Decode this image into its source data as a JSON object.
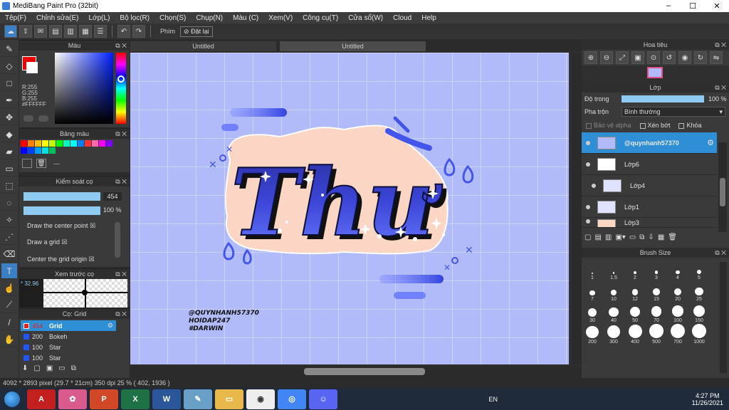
{
  "window": {
    "title": "MediBang Paint Pro (32bit)"
  },
  "menu": [
    "Tệp(F)",
    "Chỉnh sửa(E)",
    "Lớp(L)",
    "Bộ lọc(R)",
    "Chọn(S)",
    "Chụp(N)",
    "Màu (C)",
    "Xem(V)",
    "Công cụ(T)",
    "Cửa sổ(W)",
    "Cloud",
    "Help"
  ],
  "toolbar": {
    "shortcut_label": "Phím",
    "reset_label": "Đặt lại"
  },
  "color_panel": {
    "title": "Màu",
    "r": "R:255",
    "g": "G:255",
    "b": "B:255",
    "hex": "#FFFFFF"
  },
  "palette_panel": {
    "title": "Bảng màu",
    "dash": "---",
    "swatches": [
      "#ff0000",
      "#ff8000",
      "#ffbf00",
      "#ffff00",
      "#c0ff00",
      "#00ff00",
      "#00ffbf",
      "#00ffff",
      "#0080ff",
      "#ff3333",
      "#ff66aa",
      "#ff00ff",
      "#8000ff",
      "#0000ff",
      "#0040ff",
      "#00a0ff",
      "#00e0e0",
      "#00c060"
    ]
  },
  "brush_control": {
    "title": "Kiểm soát cọ",
    "size_value": "454",
    "opacity_value": "100 %",
    "size_fill": 1.0,
    "opacity_fill": 1.0,
    "options": [
      "Draw the center point",
      "Draw a grid",
      "Center the grid origin"
    ]
  },
  "preview_panel": {
    "title": "Xem trước cọ",
    "zoom": "* 32.96"
  },
  "brush_list": {
    "title": "Cọ: Grid",
    "items": [
      {
        "size": "454",
        "name": "Grid",
        "color": "#e02020"
      },
      {
        "size": "200",
        "name": "Bokeh",
        "color": "#2255ff"
      },
      {
        "size": "100",
        "name": "Star",
        "color": "#2255ff"
      },
      {
        "size": "100",
        "name": "Star",
        "color": "#2255ff"
      }
    ]
  },
  "tabs": [
    "Untitled",
    "Untitled"
  ],
  "artwork": {
    "word": "Thư",
    "watermark": [
      "@QUYNHANH57370",
      "HOIDAP247",
      "#DARWIN"
    ]
  },
  "navigator": {
    "title": "Hoa tiêu"
  },
  "layer_panel": {
    "title": "Lớp",
    "opacity_label": "Độ trong",
    "opacity_value": "100 %",
    "opacity_fill": 1.0,
    "blend_label": "Pha trộn",
    "blend_value": "Bình thường",
    "protect_alpha": "Bảo vệ alpha",
    "clip": "Xén bớt",
    "lock": "Khóa",
    "layers": [
      {
        "name": "@quynhanh57370",
        "selected": true
      },
      {
        "name": "Lớp6",
        "selected": false
      },
      {
        "name": "Lớp4",
        "selected": false
      },
      {
        "name": "Lớp1",
        "selected": false
      },
      {
        "name": "Lớp3",
        "selected": false
      }
    ]
  },
  "brush_size": {
    "title": "Brush Size",
    "sizes": [
      "1",
      "1.5",
      "2",
      "3",
      "4",
      "5",
      "7",
      "10",
      "12",
      "15",
      "20",
      "25",
      "30",
      "40",
      "50",
      "70",
      "100",
      "150",
      "200",
      "300",
      "400",
      "500",
      "700",
      "1000"
    ]
  },
  "status": {
    "text": "4092 * 2893 pixel   (29.7 * 21cm)   350 dpi   25 %   ( 402, 1936 )"
  },
  "taskbar": {
    "lang": "EN",
    "time": "4:27 PM",
    "date": "11/26/2021"
  }
}
